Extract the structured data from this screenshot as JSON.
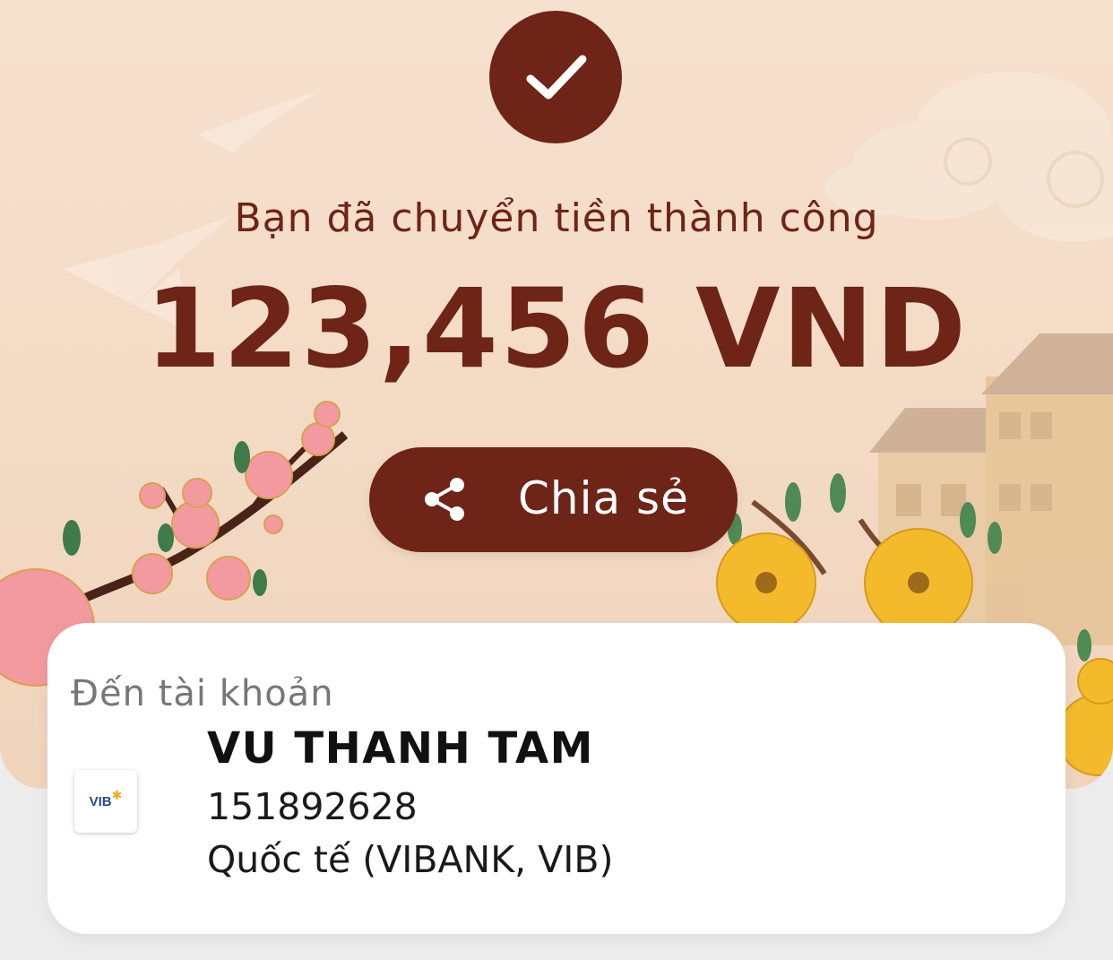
{
  "result": {
    "status_icon": "checkmark-icon",
    "message": "Bạn đã chuyển tiền thành công",
    "amount": "123,456 VND"
  },
  "share": {
    "icon": "share-icon",
    "label": "Chia sẻ"
  },
  "recipient": {
    "caption": "Đến tài khoản",
    "name": "VU THANH TAM",
    "account_number": "151892628",
    "bank": "Quốc tế (VIBANK, VIB)",
    "bank_logo_text": "VIB"
  },
  "colors": {
    "brand": "#6e2416",
    "background": "#f3dac4",
    "card": "#ffffff"
  }
}
